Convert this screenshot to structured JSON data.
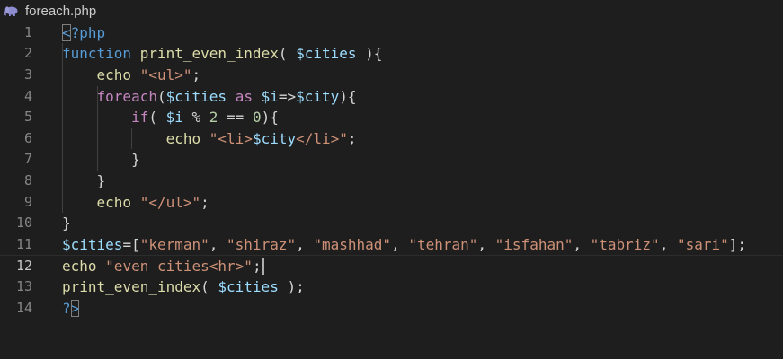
{
  "tab": {
    "filename": "foreach.php",
    "icon": "php-elephant-icon"
  },
  "editor": {
    "current_line": 12,
    "lines": [
      {
        "number": "1",
        "tokens": [
          {
            "text": "<",
            "cls": "t bracket-hl"
          },
          {
            "text": "?php",
            "cls": "t"
          }
        ]
      },
      {
        "number": "2",
        "tokens": [
          {
            "text": "function",
            "cls": "k"
          },
          {
            "text": " "
          },
          {
            "text": "print_even_index",
            "cls": "f"
          },
          {
            "text": "( "
          },
          {
            "text": "$cities",
            "cls": "v"
          },
          {
            "text": " ){"
          }
        ]
      },
      {
        "number": "3",
        "tokens": [
          {
            "text": "    "
          },
          {
            "text": "echo",
            "cls": "f"
          },
          {
            "text": " "
          },
          {
            "text": "\"<ul>\"",
            "cls": "s"
          },
          {
            "text": ";"
          }
        ]
      },
      {
        "number": "4",
        "tokens": [
          {
            "text": "    "
          },
          {
            "text": "foreach",
            "cls": "c"
          },
          {
            "text": "("
          },
          {
            "text": "$cities",
            "cls": "v"
          },
          {
            "text": " "
          },
          {
            "text": "as",
            "cls": "c"
          },
          {
            "text": " "
          },
          {
            "text": "$i",
            "cls": "v"
          },
          {
            "text": "=>"
          },
          {
            "text": "$city",
            "cls": "v"
          },
          {
            "text": "){"
          }
        ]
      },
      {
        "number": "5",
        "tokens": [
          {
            "text": "        "
          },
          {
            "text": "if",
            "cls": "c"
          },
          {
            "text": "( "
          },
          {
            "text": "$i",
            "cls": "v"
          },
          {
            "text": " % "
          },
          {
            "text": "2",
            "cls": "n"
          },
          {
            "text": " == "
          },
          {
            "text": "0",
            "cls": "n"
          },
          {
            "text": "){"
          }
        ]
      },
      {
        "number": "6",
        "tokens": [
          {
            "text": "            "
          },
          {
            "text": "echo",
            "cls": "f"
          },
          {
            "text": " "
          },
          {
            "text": "\"<li>",
            "cls": "s"
          },
          {
            "text": "$city",
            "cls": "v"
          },
          {
            "text": "</li>\"",
            "cls": "s"
          },
          {
            "text": ";"
          }
        ]
      },
      {
        "number": "7",
        "tokens": [
          {
            "text": "        }"
          }
        ]
      },
      {
        "number": "8",
        "tokens": [
          {
            "text": "    }"
          }
        ]
      },
      {
        "number": "9",
        "tokens": [
          {
            "text": "    "
          },
          {
            "text": "echo",
            "cls": "f"
          },
          {
            "text": " "
          },
          {
            "text": "\"</ul>\"",
            "cls": "s"
          },
          {
            "text": ";"
          }
        ]
      },
      {
        "number": "10",
        "tokens": [
          {
            "text": "}"
          }
        ]
      },
      {
        "number": "11",
        "tokens": [
          {
            "text": "$cities",
            "cls": "v"
          },
          {
            "text": "=["
          },
          {
            "text": "\"kerman\"",
            "cls": "s"
          },
          {
            "text": ", "
          },
          {
            "text": "\"shiraz\"",
            "cls": "s"
          },
          {
            "text": ", "
          },
          {
            "text": "\"mashhad\"",
            "cls": "s"
          },
          {
            "text": ", "
          },
          {
            "text": "\"tehran\"",
            "cls": "s"
          },
          {
            "text": ", "
          },
          {
            "text": "\"isfahan\"",
            "cls": "s"
          },
          {
            "text": ", "
          },
          {
            "text": "\"tabriz\"",
            "cls": "s"
          },
          {
            "text": ", "
          },
          {
            "text": "\"sari\"",
            "cls": "s"
          },
          {
            "text": "];"
          }
        ]
      },
      {
        "number": "12",
        "tokens": [
          {
            "text": "echo",
            "cls": "f"
          },
          {
            "text": " "
          },
          {
            "text": "\"even cities<hr>\"",
            "cls": "s"
          },
          {
            "text": ";"
          }
        ]
      },
      {
        "number": "13",
        "tokens": [
          {
            "text": "print_even_index",
            "cls": "f"
          },
          {
            "text": "( "
          },
          {
            "text": "$cities",
            "cls": "v"
          },
          {
            "text": " );"
          }
        ]
      },
      {
        "number": "14",
        "tokens": [
          {
            "text": "?",
            "cls": "t"
          },
          {
            "text": ">",
            "cls": "t bracket-hl"
          }
        ]
      }
    ]
  }
}
